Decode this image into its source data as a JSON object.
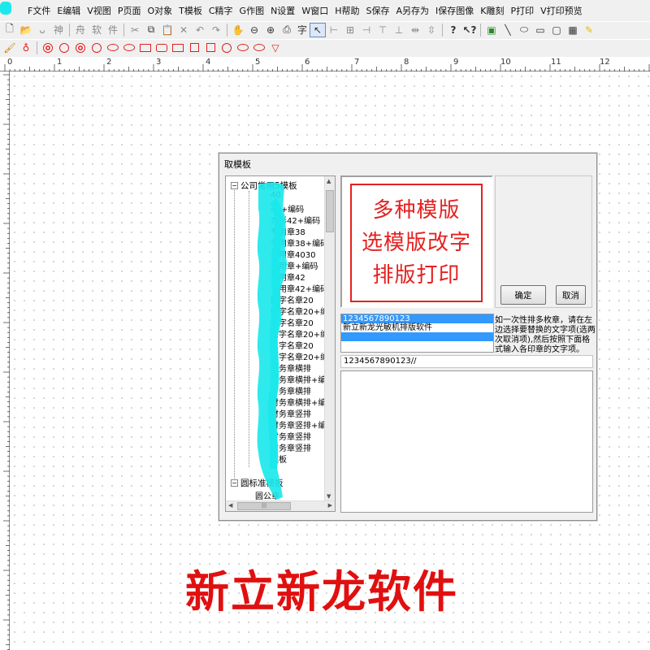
{
  "menu": [
    "F文件",
    "E编辑",
    "V视图",
    "P页面",
    "O对象",
    "T模板",
    "C精字",
    "G作图",
    "N设置",
    "W窗口",
    "H帮助",
    "S保存",
    "A另存为",
    "I保存图像",
    "K雕刻",
    "P打印",
    "V打印预览"
  ],
  "toolbar": {
    "text_button": "字",
    "gray_labels": [
      "舟",
      "软",
      "件"
    ]
  },
  "ruler": [
    "0",
    "1",
    "2",
    "3",
    "4",
    "5",
    "6",
    "7",
    "8",
    "9",
    "10",
    "11",
    "12"
  ],
  "dialog": {
    "title": "取模板",
    "tree": {
      "root1": "公司常用5模板",
      "items": [
        "40",
        "40+编码",
        "方形42+编码",
        "专用章38",
        "专用章38+编码",
        "专用章4030",
        "专用章+编码",
        "专用章42",
        "专用章42+编码",
        "四字名章20",
        "四字名章20+编码",
        "两字名章20",
        "两字名章20+编码",
        "三字名章20",
        "三字名章20+编码",
        "财务章横排",
        "财务章横排+编",
        "财务章横排",
        "财务章横排+编",
        "财务章竖排",
        "财务章竖排+编",
        "财务章竖排",
        "财务章竖排",
        "模板"
      ],
      "root2": "圆标准模板",
      "sub2": "圆公章"
    },
    "stamp_lines": [
      "多种模版",
      "选模版改字",
      "排版打印"
    ],
    "ok_label": "确定",
    "cancel_label": "取消",
    "text_items": [
      "1234567890123",
      "新立新龙光敏机排版软件",
      ""
    ],
    "hint": "如一次性排多枚章，请在左边选择要替换的文字项(选两次取消项),然后按照下面格式输入各印章的文字项。",
    "edit_value": "1234567890123//"
  },
  "watermark": "新立新龙软件",
  "colors": {
    "stamp_red": "#e52121",
    "scribble_cyan": "#1ce8ec",
    "select_blue": "#3399ff"
  }
}
